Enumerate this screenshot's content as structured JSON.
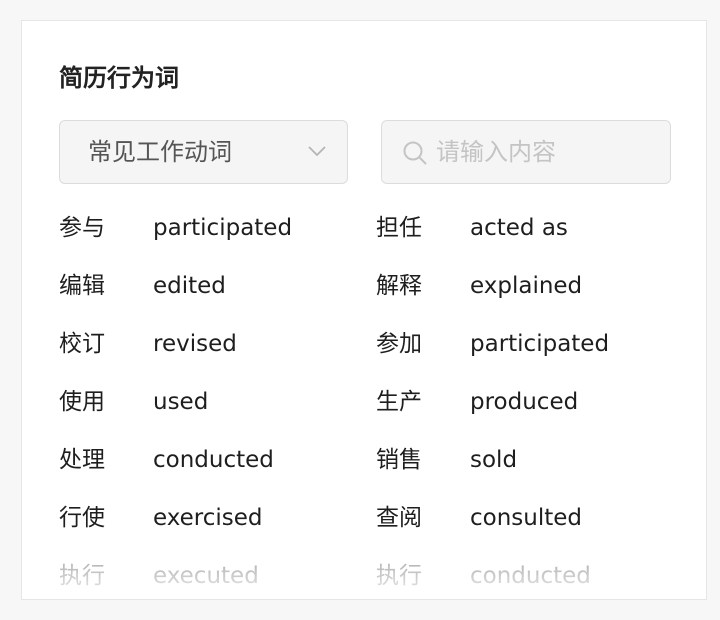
{
  "panel": {
    "title": "简历行为词"
  },
  "filter": {
    "selected": "常见工作动词",
    "icon": "chevron-down-icon"
  },
  "search": {
    "placeholder": "请输入内容",
    "value": "",
    "icon": "search-icon"
  },
  "words": [
    {
      "left_cn": "参与",
      "left_en": "participated",
      "right_cn": "担任",
      "right_en": "acted as"
    },
    {
      "left_cn": "编辑",
      "left_en": "edited",
      "right_cn": "解释",
      "right_en": "explained"
    },
    {
      "left_cn": "校订",
      "left_en": "revised",
      "right_cn": "参加",
      "right_en": "participated"
    },
    {
      "left_cn": "使用",
      "left_en": "used",
      "right_cn": "生产",
      "right_en": "produced"
    },
    {
      "left_cn": "处理",
      "left_en": "conducted",
      "right_cn": "销售",
      "right_en": "sold"
    },
    {
      "left_cn": "行使",
      "left_en": "exercised",
      "right_cn": "查阅",
      "right_en": "consulted"
    },
    {
      "left_cn": "执行",
      "left_en": "executed",
      "right_cn": "执行",
      "right_en": "conducted"
    }
  ],
  "colors": {
    "text": "#1e1e1e",
    "placeholder": "#c4c4c4",
    "field_bg": "#f5f5f5",
    "field_border": "#dcdcdc"
  }
}
